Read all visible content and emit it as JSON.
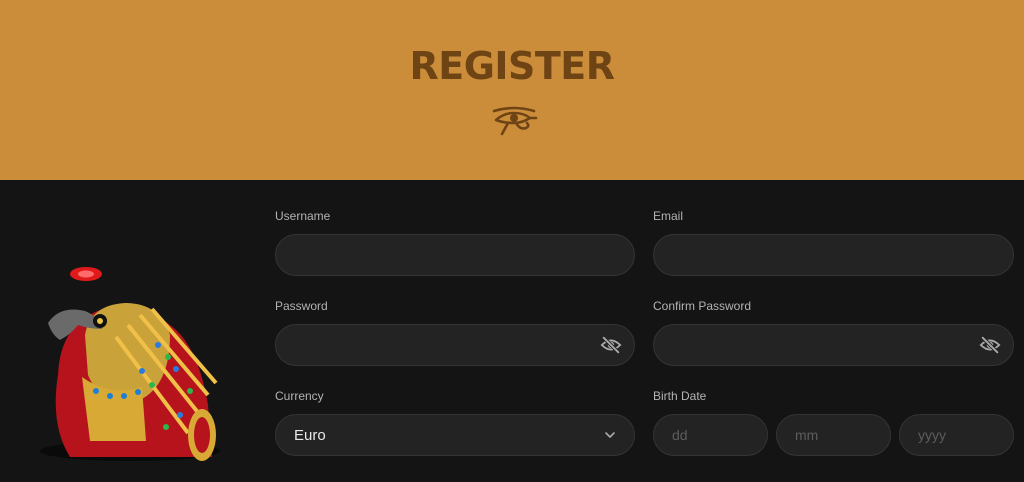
{
  "header": {
    "title": "REGISTER"
  },
  "form": {
    "username": {
      "label": "Username",
      "value": ""
    },
    "email": {
      "label": "Email",
      "value": ""
    },
    "password": {
      "label": "Password",
      "value": ""
    },
    "confirm_password": {
      "label": "Confirm Password",
      "value": ""
    },
    "currency": {
      "label": "Currency",
      "selected": "Euro"
    },
    "birth_date": {
      "label": "Birth Date",
      "day_placeholder": "dd",
      "month_placeholder": "mm",
      "year_placeholder": "yyyy"
    }
  },
  "icons": {
    "header_icon": "eye-of-horus-icon",
    "password_toggle": "eye-off-icon",
    "currency_dropdown": "chevron-down-icon"
  },
  "colors": {
    "header_bg": "#cc8d3b",
    "title": "#6e4415",
    "page_bg": "#141414",
    "input_bg": "#232323"
  }
}
